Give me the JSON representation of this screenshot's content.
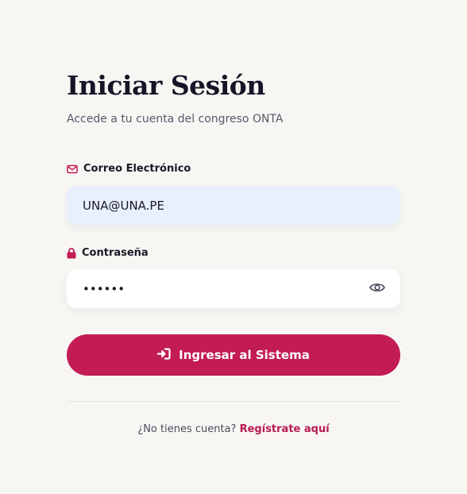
{
  "login": {
    "title": "Iniciar Sesión",
    "subtitle": "Accede a tu cuenta del congreso ONTA",
    "email": {
      "label": "Correo Electrónico",
      "value": "UNA@UNA.PE",
      "icon": "envelope-icon"
    },
    "password": {
      "label": "Contraseña",
      "value": "••••••",
      "icon": "lock-icon",
      "toggle_icon": "eye-icon"
    },
    "submit": {
      "label": "Ingresar al Sistema",
      "icon": "sign-in-icon"
    },
    "footer": {
      "prompt": "¿No tienes cuenta?",
      "link": "Regístrate aquí"
    }
  },
  "colors": {
    "background": "#f8f6f3",
    "accent": "#c21b56",
    "email_field_bg": "#e8f0fd",
    "password_field_bg": "#ffffff"
  }
}
